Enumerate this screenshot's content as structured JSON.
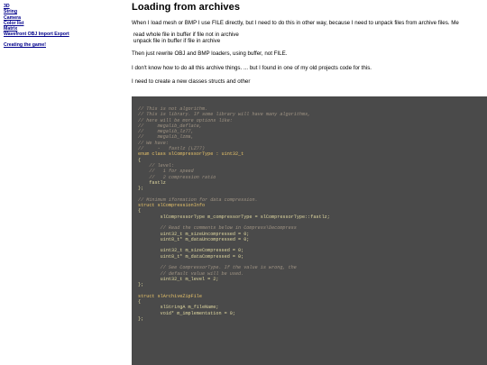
{
  "sidebar": {
    "links": [
      "3D",
      "String",
      "Camera",
      "Color list",
      "Matrix",
      "Wavefront OBJ Import Export"
    ],
    "extra_link": "Creating the game!"
  },
  "article": {
    "title": "Loading from archives",
    "intro": "When I load mesh or BMP I use FILE directly, but I need to do this in other way, because I need to unpack files from archive files. Me",
    "bullets": [
      "read whole file in buffer if file not in archive",
      "unpack file in buffer if file in archive"
    ],
    "p2": "Then just rewrite OBJ and BMP loaders, using buffer, not FILE.",
    "p3": "I don't know how to do all this archive things. ... but I found in one of my old projects code for this.",
    "p4": "I need to create a new classes structs and other"
  },
  "code_lines": [
    {
      "t": "// This is not algorithm.",
      "k": "comment"
    },
    {
      "t": "// This is library. If some library will have many algorithms,",
      "k": "comment"
    },
    {
      "t": "// here will be more options like:",
      "k": "comment"
    },
    {
      "t": "//     megalib_deflate,",
      "k": "comment"
    },
    {
      "t": "//     megalib_lz77,",
      "k": "comment"
    },
    {
      "t": "//     megalib_lzma,",
      "k": "comment"
    },
    {
      "t": "// We have:",
      "k": "comment"
    },
    {
      "t": "//     -   fastlz (LZ77)",
      "k": "comment"
    },
    {
      "t": "enum class slCompressorType : uint32_t",
      "k": "keyword"
    },
    {
      "t": "{",
      "k": "code"
    },
    {
      "t": "    // level:",
      "k": "comment"
    },
    {
      "t": "    //   1 for speed",
      "k": "comment"
    },
    {
      "t": "    //   2 compression ratio",
      "k": "comment"
    },
    {
      "t": "    fastlz",
      "k": "code"
    },
    {
      "t": "};",
      "k": "code"
    },
    {
      "t": "",
      "k": "blank"
    },
    {
      "t": "// Minimum iformation for data compression.",
      "k": "comment"
    },
    {
      "t": "struct slCompressionInfo",
      "k": "keyword"
    },
    {
      "t": "{",
      "k": "code"
    },
    {
      "t": "        slCompressorType m_compressorType = slCompressorType::fastlz;",
      "k": "code"
    },
    {
      "t": "",
      "k": "blank"
    },
    {
      "t": "        // Read the comments below in Compress\\Decompress",
      "k": "comment"
    },
    {
      "t": "        uint32_t m_sizeUncompressed = 0;",
      "k": "code"
    },
    {
      "t": "        uint8_t* m_dataUncompressed = 0;",
      "k": "code"
    },
    {
      "t": "",
      "k": "blank"
    },
    {
      "t": "        uint32_t m_sizeCompressed = 0;",
      "k": "code"
    },
    {
      "t": "        uint8_t* m_dataCompressed = 0;",
      "k": "code"
    },
    {
      "t": "",
      "k": "blank"
    },
    {
      "t": "        // See CompressorType. If the value is wrong, the",
      "k": "comment"
    },
    {
      "t": "        // default value will be used.",
      "k": "comment"
    },
    {
      "t": "        uint32_t m_level = 2;",
      "k": "code"
    },
    {
      "t": "};",
      "k": "code"
    },
    {
      "t": "",
      "k": "blank"
    },
    {
      "t": "struct slArchiveZipFile",
      "k": "keyword"
    },
    {
      "t": "{",
      "k": "code"
    },
    {
      "t": "        slStringA m_fileName;",
      "k": "code"
    },
    {
      "t": "        void* m_implementation = 0;",
      "k": "code"
    },
    {
      "t": "};",
      "k": "code"
    }
  ]
}
